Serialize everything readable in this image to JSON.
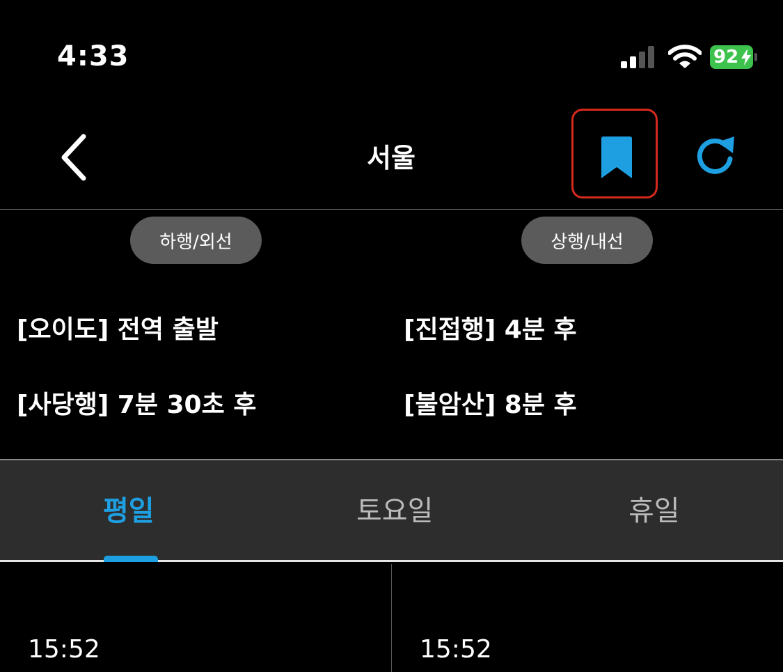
{
  "status_bar": {
    "time": "4:33",
    "battery": "92",
    "battery_color": "#3dc24e",
    "icons": [
      "cellular-signal-icon",
      "wifi-icon",
      "battery-charging-icon"
    ]
  },
  "header": {
    "title": "서울",
    "back_icon": "chevron-left-icon",
    "bookmark_icon": "bookmark-icon",
    "refresh_icon": "refresh-icon",
    "accent_color": "#1e9fe1",
    "highlight_color": "#d42a1c"
  },
  "directions": {
    "down": "하행/외선",
    "up": "상행/내선"
  },
  "arrivals": [
    "[오이도] 전역 출발",
    "[진접행] 4분 후",
    "[사당행] 7분 30초 후",
    "[불암산] 8분 후"
  ],
  "tabs": [
    {
      "label": "평일",
      "selected": true
    },
    {
      "label": "토요일",
      "selected": false
    },
    {
      "label": "휴일",
      "selected": false
    }
  ],
  "timetable": {
    "left": [
      "15:52"
    ],
    "right": [
      "15:52"
    ]
  }
}
